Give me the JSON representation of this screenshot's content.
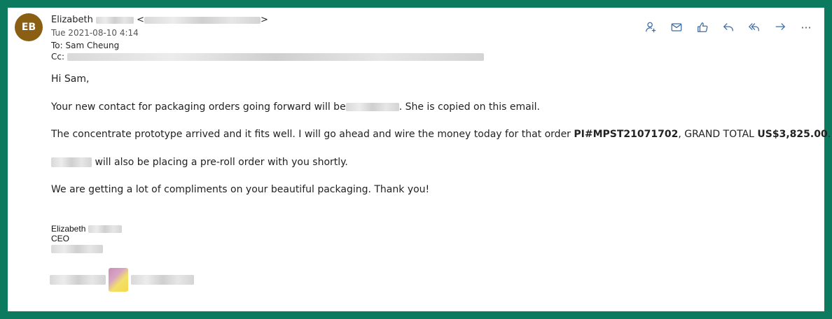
{
  "header": {
    "avatar_initials": "EB",
    "sender_name": "Elizabeth",
    "sender_open_bracket": "<",
    "sender_close_bracket": ">",
    "date": "Tue 2021-08-10 4:14",
    "to_label": "To:",
    "to_value": "Sam Cheung",
    "cc_label": "Cc:"
  },
  "toolbar": {
    "icons": [
      "person-add-icon",
      "mail-icon",
      "thumbs-up-icon",
      "reply-icon",
      "reply-all-icon",
      "forward-icon",
      "more-icon"
    ],
    "more_label": "···"
  },
  "body": {
    "greeting": "Hi Sam,",
    "p2_before": "Your new contact for packaging orders going forward will be",
    "p2_after": ". She is copied on this email.",
    "p3_before": "The concentrate prototype arrived and it fits well. I will go ahead and wire the money today for that order ",
    "p3_order": "PI#MPST21071702",
    "p3_mid": ", GRAND TOTAL ",
    "p3_total": "US$3,825.00",
    "p3_end": ".",
    "p4_after": " will also be placing a pre-roll order with you shortly.",
    "p5": "We are getting a lot of compliments on your beautiful packaging. Thank you!"
  },
  "signature": {
    "name": "Elizabeth",
    "title": "CEO"
  },
  "colors": {
    "frame_border": "#0b7a5e",
    "avatar_bg": "#8a5e13",
    "icon_color": "#3d6ca5"
  }
}
